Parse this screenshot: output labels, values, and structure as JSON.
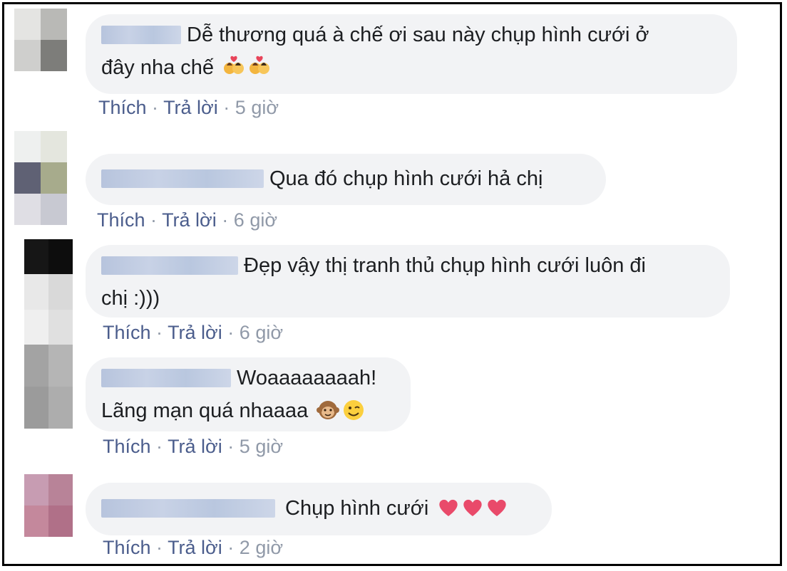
{
  "comments": [
    {
      "text_line1": "Dễ thương quá à chế ơi sau này chụp hình cưới ở",
      "text_line2": "đây nha chế",
      "emoji": [
        "couple-with-heart-emoji",
        "couple-with-heart-emoji"
      ],
      "like": "Thích",
      "reply": "Trả lời",
      "time": "5 giờ",
      "avatar_colors": [
        "#e4e4e2",
        "#b9b9b6",
        "#cfcfcd",
        "#7d7d7a"
      ]
    },
    {
      "text_line1": "Qua đó chụp hình cưới hả chị",
      "like": "Thích",
      "reply": "Trả lời",
      "time": "6 giờ",
      "avatar_colors": [
        "#eef0ef",
        "#e4e6de",
        "#5f6174",
        "#a7ab8c",
        "#dfdee4",
        "#c8c9d2"
      ]
    },
    {
      "text_line1": "Đẹp vậy thị tranh thủ chụp hình cưới luôn đi",
      "text_line2": "chị :)))",
      "like": "Thích",
      "reply": "Trả lời",
      "time": "6 giờ",
      "avatar_colors": [
        "#161616",
        "#0d0d0d",
        "#e8e8e8",
        "#d9d9d9",
        "#efefef",
        "#e0e0e0"
      ]
    },
    {
      "text_line1": "Woaaaaaaaah!",
      "text_line2": "Lãng mạn quá nhaaaa",
      "emoji": [
        "monkey-emoji",
        "winking-face-emoji"
      ],
      "like": "Thích",
      "reply": "Trả lời",
      "time": "5 giờ",
      "avatar_colors": [
        "#a3a3a3",
        "#b5b5b5",
        "#9b9b9b",
        "#adadad"
      ]
    },
    {
      "text_line1": "Chụp hình cưới",
      "emoji": [
        "red-heart-emoji",
        "red-heart-emoji",
        "red-heart-emoji"
      ],
      "like": "Thích",
      "reply": "Trả lời",
      "time": "2 giờ",
      "avatar_colors": [
        "#c79cb2",
        "#b88398",
        "#c4889c",
        "#b07088"
      ]
    }
  ],
  "separator": "·"
}
